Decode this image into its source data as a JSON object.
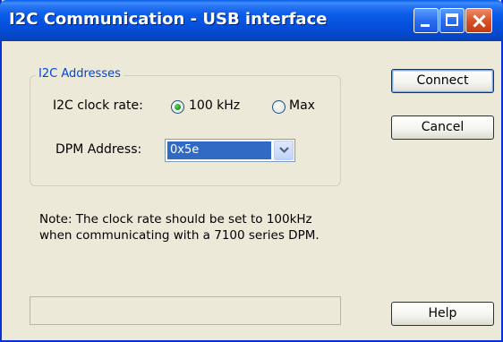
{
  "window": {
    "title": "I2C Communication - USB interface",
    "titlebar_color": "#0451dd",
    "close_color": "#d9532a"
  },
  "addresses_group": {
    "legend": "I2C Addresses",
    "legend_color": "#0046d5",
    "clock_rate_label": "I2C clock rate:",
    "clock_rate_options": [
      "100 kHz",
      "Max"
    ],
    "clock_rate_selected": "100 kHz",
    "dpm_address_label": "DPM Address:",
    "dpm_address_value": "0x5e",
    "selection_color": "#316ac5"
  },
  "note": "Note: The clock rate should be set to 100kHz when communicating with a 7100 series DPM.",
  "buttons": {
    "connect": "Connect",
    "cancel": "Cancel",
    "help": "Help"
  },
  "status_text": ""
}
